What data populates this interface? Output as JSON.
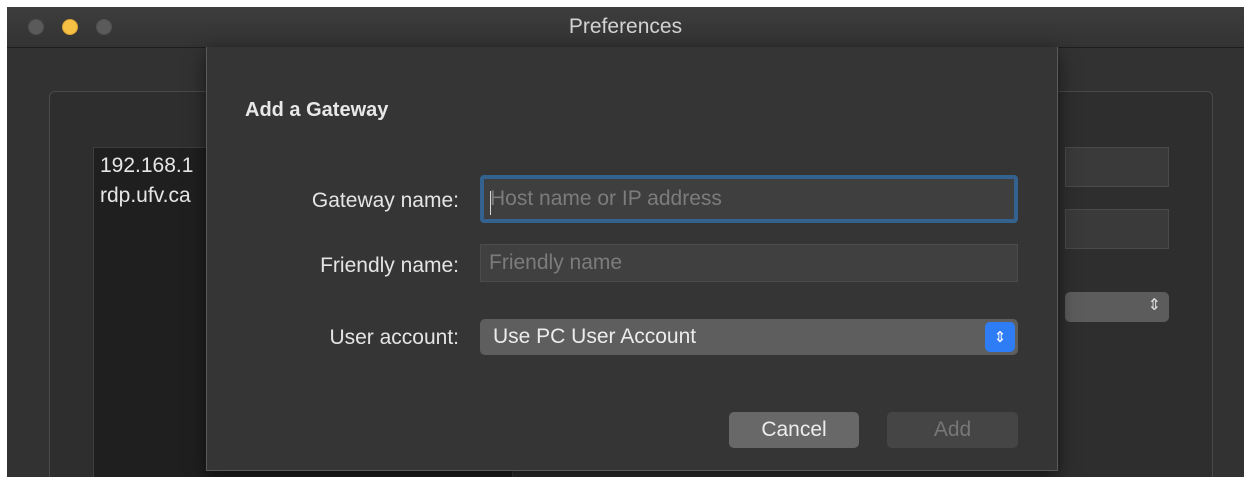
{
  "window": {
    "title": "Preferences"
  },
  "background": {
    "list_items": [
      "192.168.1",
      "rdp.ufv.ca"
    ]
  },
  "dialog": {
    "title": "Add a Gateway",
    "gateway_name": {
      "label": "Gateway name:",
      "value": "",
      "placeholder": "Host name or IP address"
    },
    "friendly_name": {
      "label": "Friendly name:",
      "value": "",
      "placeholder": "Friendly name"
    },
    "user_account": {
      "label": "User account:",
      "selected": "Use PC User Account"
    },
    "buttons": {
      "cancel": "Cancel",
      "add": "Add"
    }
  },
  "colors": {
    "accent": "#2f7df6",
    "focus_ring": "#34628f",
    "minimize_light": "#f6c045"
  },
  "icons": {
    "stepper": "chevron-up-down-icon"
  }
}
